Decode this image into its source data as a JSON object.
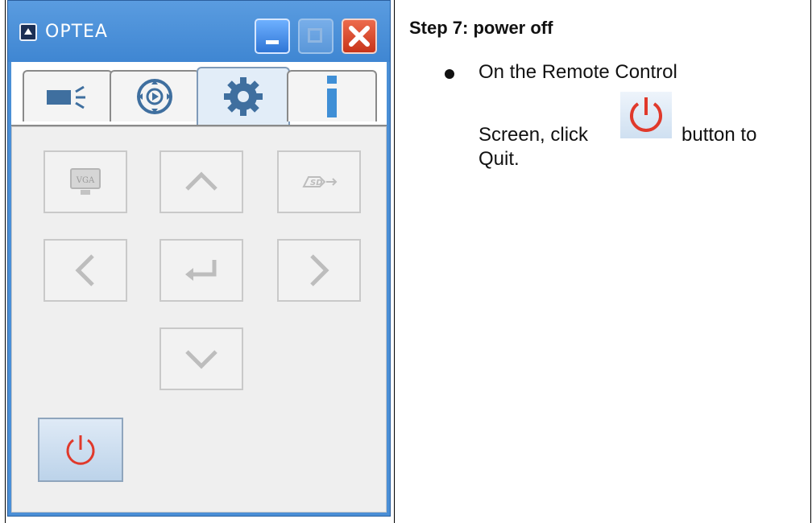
{
  "window": {
    "title": "OPTEA",
    "controls": [
      "minimize",
      "maximize",
      "close"
    ]
  },
  "tabs": [
    {
      "id": "camera",
      "icon": "camera-icon",
      "active": false
    },
    {
      "id": "playback",
      "icon": "playback-icon",
      "active": false
    },
    {
      "id": "settings",
      "icon": "gear-icon",
      "active": true
    },
    {
      "id": "info",
      "icon": "info-icon",
      "active": false
    }
  ],
  "remote_buttons": [
    {
      "id": "vga",
      "label": "VGA",
      "icon": "vga-monitor-icon",
      "enabled": false
    },
    {
      "id": "up",
      "icon": "arrow-up-icon",
      "enabled": false
    },
    {
      "id": "sd",
      "label": "SD",
      "icon": "sd-card-icon",
      "enabled": false
    },
    {
      "id": "left",
      "icon": "arrow-left-icon",
      "enabled": false
    },
    {
      "id": "enter",
      "icon": "enter-icon",
      "enabled": false
    },
    {
      "id": "right",
      "icon": "arrow-right-icon",
      "enabled": false
    },
    {
      "id": "down",
      "icon": "arrow-down-icon",
      "enabled": false
    },
    {
      "id": "power",
      "icon": "power-icon",
      "enabled": true
    }
  ],
  "doc": {
    "step_title": "Step 7: power off",
    "line1": "On the Remote Control",
    "line2_before": "Screen, click",
    "line2_after": "button to",
    "line3": "Quit."
  },
  "colors": {
    "titlebar": "#4b8fd6",
    "active_tab_icon": "#3f6f9f",
    "power_red": "#e0392b",
    "disabled_icon": "#b8b8b8"
  }
}
